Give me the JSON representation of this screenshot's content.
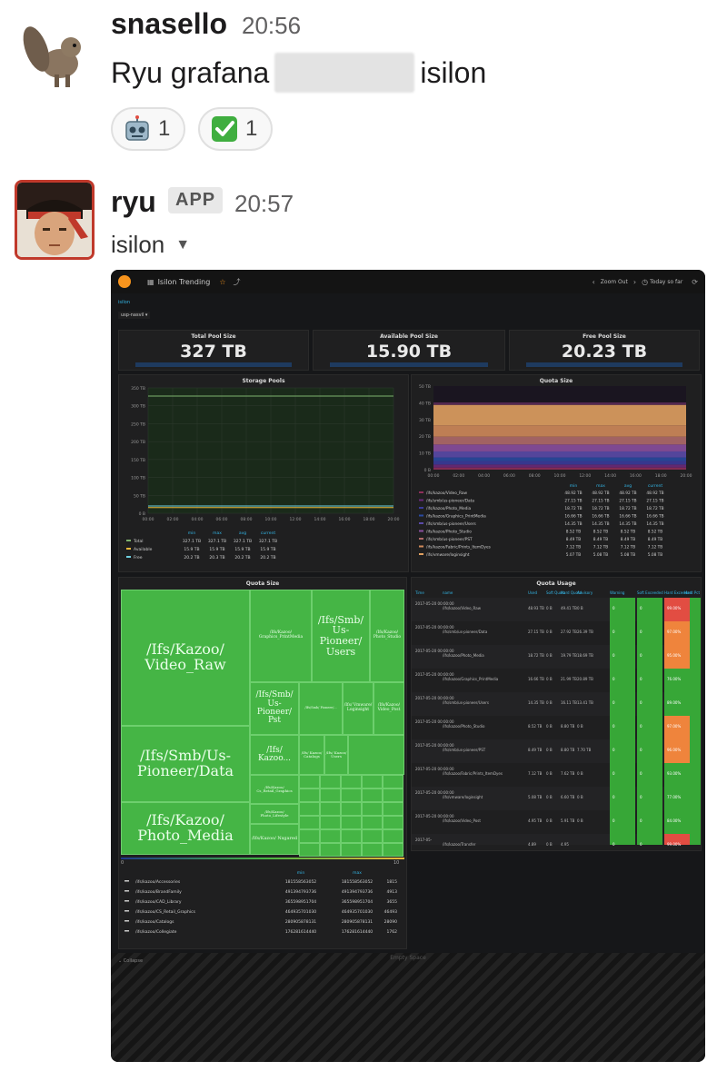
{
  "message1": {
    "sender": "snasello",
    "time": "20:56",
    "text_before": "Ryu grafana",
    "text_after": "isilon",
    "reactions": [
      {
        "emoji": "robot-face",
        "count": "1"
      },
      {
        "emoji": "white-check-mark",
        "count": "1"
      }
    ]
  },
  "message2": {
    "sender": "ryu",
    "badge": "APP",
    "time": "20:57",
    "subtitle": "isilon"
  },
  "grafana": {
    "dashboard_title": "Isilon Trending",
    "zoom_out": "Zoom Out",
    "time_range": "Today so far",
    "var_label": "isilon",
    "var_value": "usp-nasvil",
    "collapse": "Collapse",
    "stats": [
      {
        "title": "Total Pool Size",
        "value": "327 TB"
      },
      {
        "title": "Available Pool Size",
        "value": "15.90 TB"
      },
      {
        "title": "Free Pool Size",
        "value": "20.23 TB"
      }
    ],
    "storage_pools": {
      "title": "Storage Pools",
      "y_ticks": [
        "350 TB",
        "300 TB",
        "250 TB",
        "200 TB",
        "150 TB",
        "100 TB",
        "50 TB",
        "0 B"
      ],
      "x_ticks": [
        "00:00",
        "02:00",
        "04:00",
        "06:00",
        "08:00",
        "10:00",
        "12:00",
        "14:00",
        "16:00",
        "18:00",
        "20:00"
      ],
      "legend_headers": [
        "min",
        "max",
        "avg",
        "current"
      ],
      "legend": [
        {
          "name": "Total",
          "color": "#7eb26d",
          "vals": [
            "327.1 TB",
            "327.1 TB",
            "327.1 TB",
            "327.1 TB"
          ]
        },
        {
          "name": "Available",
          "color": "#eab839",
          "vals": [
            "15.9 TB",
            "15.9 TB",
            "15.9 TB",
            "15.9 TB"
          ]
        },
        {
          "name": "Free",
          "color": "#6ed0e0",
          "vals": [
            "20.2 TB",
            "20.3 TB",
            "20.2 TB",
            "20.2 TB"
          ]
        }
      ]
    },
    "quota_size_top": {
      "title": "Quota Size",
      "y_ticks": [
        "50 TB",
        "40 TB",
        "30 TB",
        "20 TB",
        "10 TB",
        "0 B"
      ],
      "x_ticks": [
        "00:00",
        "02:00",
        "04:00",
        "06:00",
        "08:00",
        "10:00",
        "12:00",
        "14:00",
        "16:00",
        "18:00",
        "20:00"
      ],
      "legend_headers": [
        "min",
        "max",
        "avg",
        "current"
      ],
      "legend": [
        {
          "name": "/ifs/kazoo/Video_Raw",
          "vals": [
            "48.92 TB",
            "48.92 TB",
            "48.92 TB",
            "48.92 TB"
          ]
        },
        {
          "name": "/ifs/smb/us-pioneer/Data",
          "vals": [
            "27.15 TB",
            "27.15 TB",
            "27.15 TB",
            "27.15 TB"
          ]
        },
        {
          "name": "/ifs/kazoo/Photo_Media",
          "vals": [
            "18.72 TB",
            "18.72 TB",
            "18.72 TB",
            "18.72 TB"
          ]
        },
        {
          "name": "/ifs/kazoo/Graphics_PrintMedia",
          "vals": [
            "16.66 TB",
            "16.66 TB",
            "16.66 TB",
            "16.66 TB"
          ]
        },
        {
          "name": "/ifs/smb/us-pioneer/Users",
          "vals": [
            "14.35 TB",
            "14.35 TB",
            "14.35 TB",
            "14.35 TB"
          ]
        },
        {
          "name": "/ifs/kazoo/Photo_Studio",
          "vals": [
            "8.52 TB",
            "8.52 TB",
            "8.52 TB",
            "8.52 TB"
          ]
        },
        {
          "name": "/ifs/smb/us-pioneer/PST",
          "vals": [
            "8.49 TB",
            "8.49 TB",
            "8.49 TB",
            "8.49 TB"
          ]
        },
        {
          "name": "/ifs/kazoo/Fabric/Prints_ItemDyes",
          "vals": [
            "7.12 TB",
            "7.12 TB",
            "7.12 TB",
            "7.12 TB"
          ]
        },
        {
          "name": "/ifs/vmware/loginsight",
          "vals": [
            "5.07 TB",
            "5.08 TB",
            "5.08 TB",
            "5.08 TB"
          ]
        }
      ]
    },
    "treemap": {
      "title": "Quota Size",
      "scale_min": "0",
      "scale_max": "10",
      "big": [
        "/Ifs/Kazoo/ Video_Raw",
        "/Ifs/Smb/Us- Pioneer/Data",
        "/Ifs/Kazoo/ Photo_Media"
      ],
      "medium": [
        "/Ifs/Smb/ Us- Pioneer/ Users",
        "/Ifs/Smb/ Us- Pioneer/ Pst",
        "/Ifs/ Kazoo..."
      ],
      "small": [
        "/Ifs/Kazoo/ Graphics_PrintMedia",
        "/Ifs/Kazoo/ Photo_Studio",
        "/Ifs/Kazoo/ Cs_Retail_Graphics",
        "/Ifs/Kazoo/ Photo_Lifestyle",
        "/Ifs/Kazoo/ Nsgared",
        "/Ifs/ Vmware/ Loginsight",
        "/Ifs/Kazoo/ Video_Post",
        "/Ifs/ Kazoo/ Catalogs",
        "/Ifs/ Kazoo/ Users"
      ],
      "table_headers": [
        "min",
        "max"
      ],
      "rows": [
        {
          "name": "/ifs/kazoo/Accessories",
          "min": "181558563052",
          "max": "181558563052",
          "cur": "1815"
        },
        {
          "name": "/ifs/kazoo/BrandFamily",
          "min": "491394793736",
          "max": "491394793736",
          "cur": "4913"
        },
        {
          "name": "/ifs/kazoo/CAD_Library",
          "min": "365598951704",
          "max": "365598951704",
          "cur": "3655"
        },
        {
          "name": "/ifs/kazoo/CS_Retail_Graphics",
          "min": "464935701030",
          "max": "464935701030",
          "cur": "46493"
        },
        {
          "name": "/ifs/kazoo/Catalogs",
          "min": "280905878131",
          "max": "280905878131",
          "cur": "28090"
        },
        {
          "name": "/ifs/kazoo/Collegiate",
          "min": "176281614440",
          "max": "176281614440",
          "cur": "1762"
        }
      ]
    },
    "quota_usage": {
      "title": "Quota Usage",
      "headers": [
        "Time",
        "name",
        "Used",
        "Soft Quota",
        "Hard Quota",
        "Advisory",
        "Warning",
        "Soft Exceeded",
        "Hard Exceeded",
        "Hard Pct"
      ],
      "rows": [
        {
          "time": "2017-05-20 00:00:00",
          "name": "/ifs/kazoo/Video_Raw",
          "used": "48.93 TB",
          "soft": "0 B",
          "hard": "49.41 TB",
          "adv": "0 B",
          "pct": "99.00%",
          "pctcolor": "#e24d42"
        },
        {
          "time": "2017-05-20 00:00:00",
          "name": "/ifs/smb/us-pioneer/Data",
          "used": "27.15 TB",
          "soft": "0 B",
          "hard": "27.92 TB",
          "adv": "26.39 TB",
          "pct": "97.00%",
          "pctcolor": "#ef843c"
        },
        {
          "time": "2017-05-20 00:00:00",
          "name": "/ifs/kazoo/Photo_Media",
          "used": "18.72 TB",
          "soft": "0 B",
          "hard": "19.79 TB",
          "adv": "18.69 TB",
          "pct": "95.00%",
          "pctcolor": "#ef843c"
        },
        {
          "time": "2017-05-20 00:00:00",
          "name": "/ifs/kazoo/Graphics_PrintMedia",
          "used": "16.66 TB",
          "soft": "0 B",
          "hard": "21.99 TB",
          "adv": "20.89 TB",
          "pct": "76.00%",
          "pctcolor": "#37a737"
        },
        {
          "time": "2017-05-20 00:00:00",
          "name": "/ifs/smb/us-pioneer/Users",
          "used": "14.35 TB",
          "soft": "0 B",
          "hard": "16.11 TB",
          "adv": "13.41 TB",
          "pct": "89.00%",
          "pctcolor": "#37a737"
        },
        {
          "time": "2017-05-20 00:00:00",
          "name": "/ifs/kazoo/Photo_Studio",
          "used": "8.52 TB",
          "soft": "0 B",
          "hard": "8.80 TB",
          "adv": "0 B",
          "pct": "97.00%",
          "pctcolor": "#ef843c"
        },
        {
          "time": "2017-05-20 00:00:00",
          "name": "/ifs/smb/us-pioneer/PST",
          "used": "8.49 TB",
          "soft": "0 B",
          "hard": "8.80 TB",
          "adv": "7.70 TB",
          "pct": "96.00%",
          "pctcolor": "#ef843c"
        },
        {
          "time": "2017-05-20 00:00:00",
          "name": "/ifs/kazoo/Fabric/Prints_ItemDyes",
          "used": "7.12 TB",
          "soft": "0 B",
          "hard": "7.62 TB",
          "adv": "0 B",
          "pct": "93.00%",
          "pctcolor": "#37a737"
        },
        {
          "time": "2017-05-20 00:00:00",
          "name": "/ifs/vmware/loginsight",
          "used": "5.08 TB",
          "soft": "0 B",
          "hard": "6.60 TB",
          "adv": "0 B",
          "pct": "77.00%",
          "pctcolor": "#37a737"
        },
        {
          "time": "2017-05-20 00:00:00",
          "name": "/ifs/kazoo/Video_Post",
          "used": "4.95 TB",
          "soft": "0 B",
          "hard": "5.91 TB",
          "adv": "0 B",
          "pct": "84.00%",
          "pctcolor": "#37a737"
        },
        {
          "time": "2017-05-",
          "name": "/ifs/kazoo/Transfer",
          "used": "4.89",
          "soft": "0 B",
          "hard": "4.95",
          "adv": "",
          "pct": "99.00%",
          "pctcolor": "#e24d42"
        }
      ]
    },
    "empty_space": "Empty Space"
  }
}
